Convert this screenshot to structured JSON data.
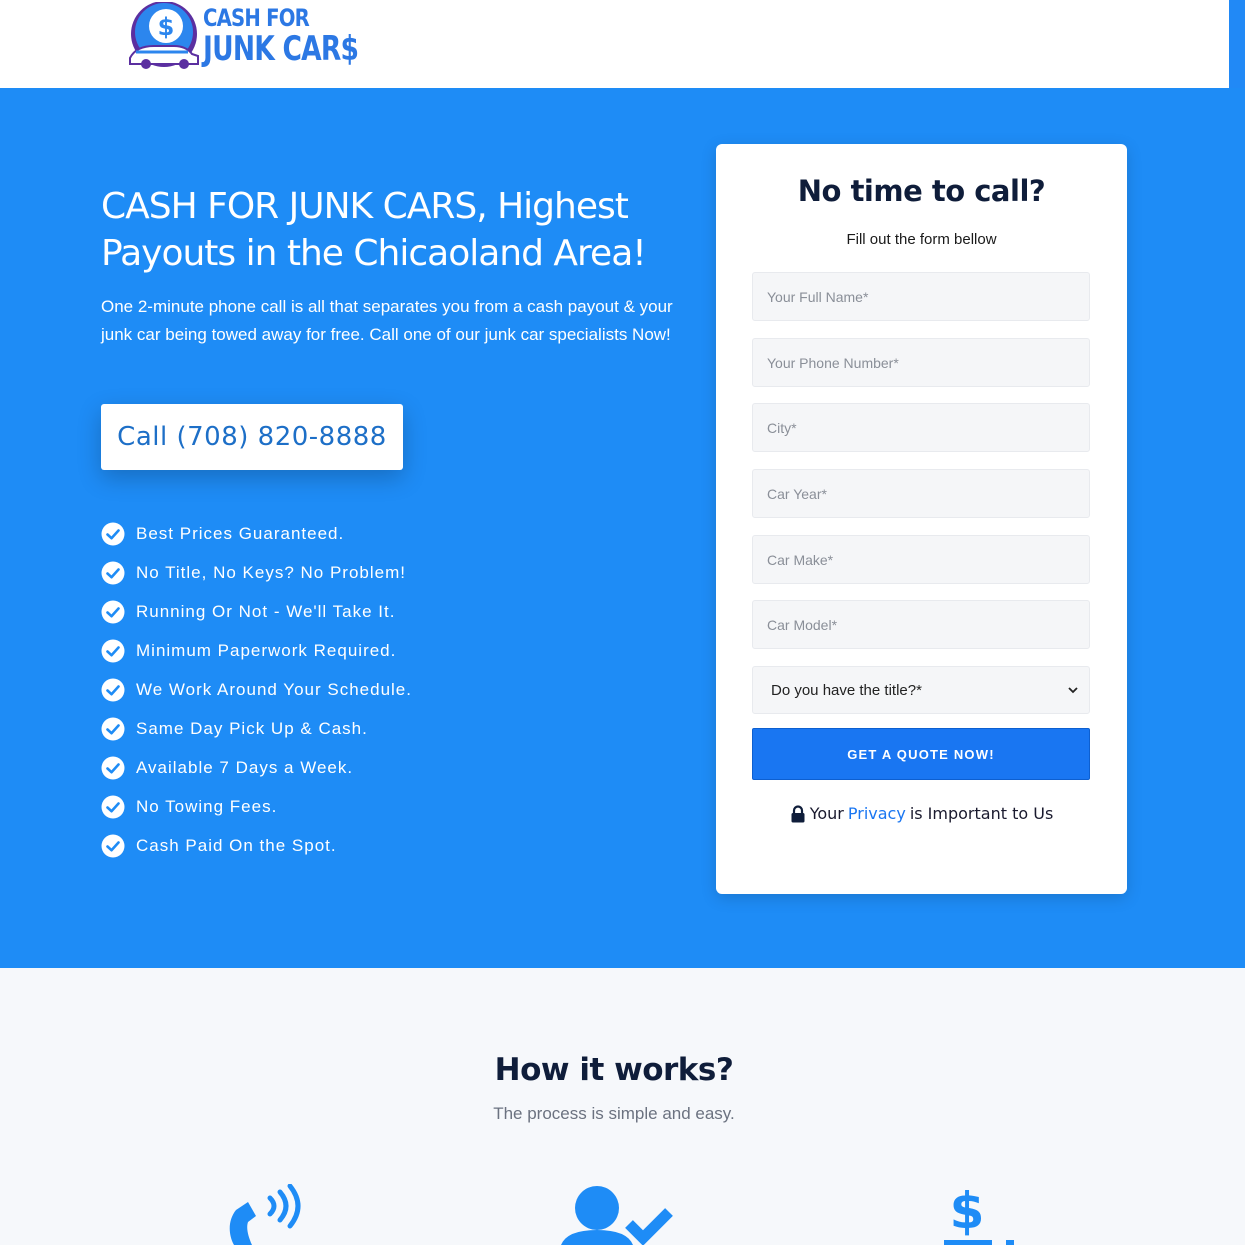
{
  "brand": {
    "logo_line1": "CASH FOR",
    "logo_line2": "JUNK CAR$",
    "primary_color": "#1e8cf6",
    "button_color": "#1976f2"
  },
  "hero": {
    "title": "CASH FOR JUNK CARS, Highest Payouts in the Chicaoland Area!",
    "text": "One 2-minute phone call is all that separates you from a cash payout & your junk car being towed away for free. Call one of our junk car specialists Now!",
    "call_button": "Call (708) 820-8888",
    "features": [
      "Best Prices Guaranteed.",
      "No Title, No Keys? No Problem!",
      "Running Or Not - We'll Take It.",
      "Minimum Paperwork Required.",
      "We Work Around Your Schedule.",
      "Same Day Pick Up & Cash.",
      "Available 7 Days a Week.",
      "No Towing Fees.",
      "Cash Paid On the Spot."
    ]
  },
  "form": {
    "title": "No time to call?",
    "subtitle": "Fill out the form bellow",
    "fields": {
      "full_name": "Your Full Name*",
      "phone": "Your Phone Number*",
      "city": "City*",
      "car_year": "Car Year*",
      "car_make": "Car Make*",
      "car_model": "Car Model*"
    },
    "title_select": "Do you have the title?*",
    "submit": "GET A QUOTE NOW!",
    "privacy_prefix": "Your",
    "privacy_link": "Privacy",
    "privacy_suffix": "is Important to Us"
  },
  "how": {
    "title": "How it works?",
    "subtitle": "The process is simple and easy.",
    "icons": [
      "phone-call-icon",
      "user-check-icon",
      "dollar-icon"
    ]
  }
}
